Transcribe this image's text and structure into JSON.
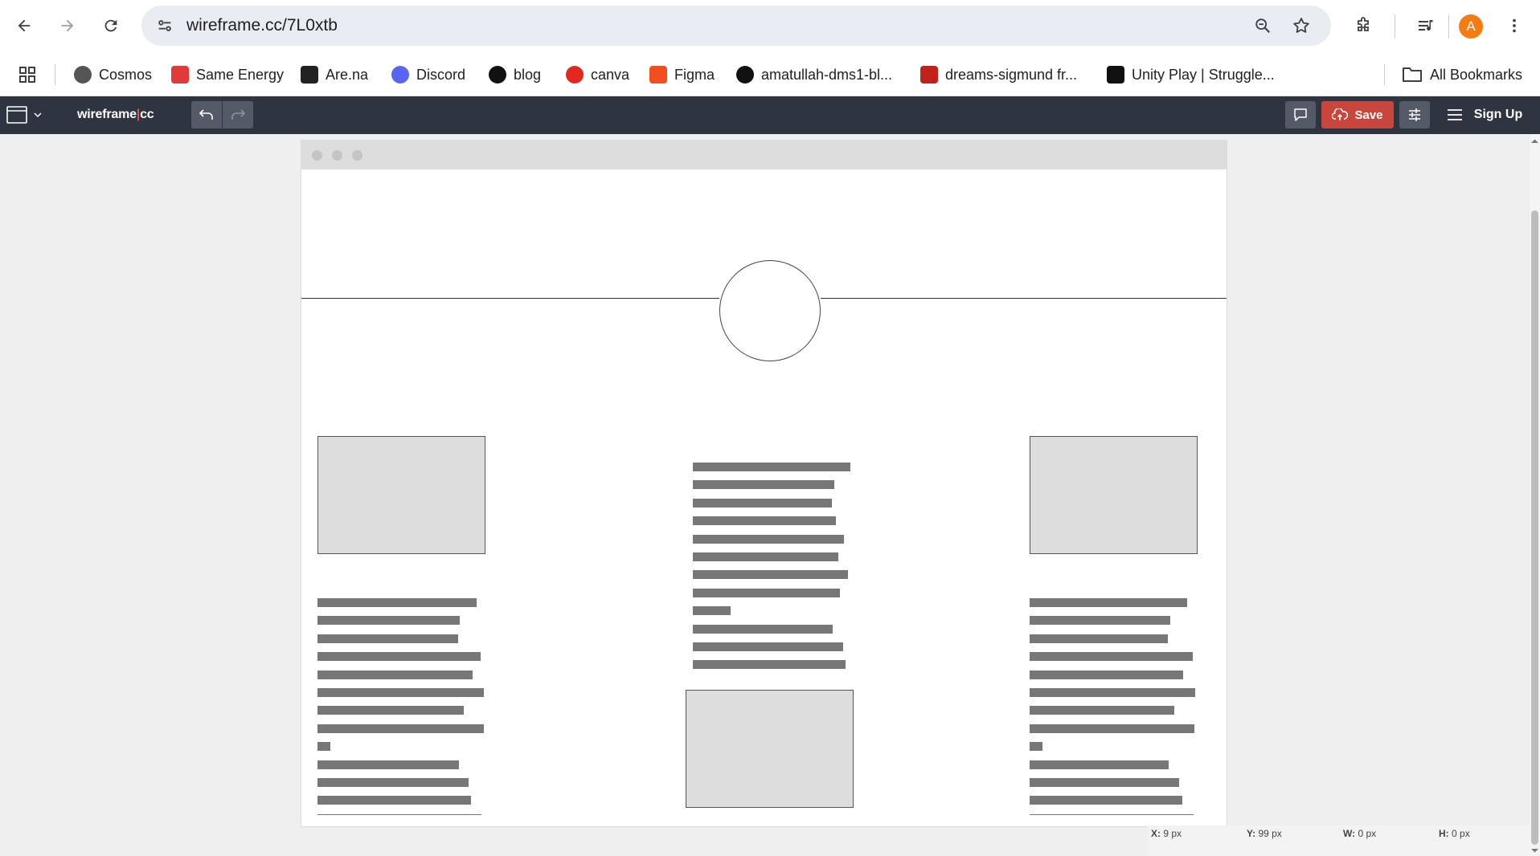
{
  "browser": {
    "url": "wireframe.cc/7L0xtb",
    "profile_initial": "A",
    "bookmarks": [
      {
        "label": "Cosmos",
        "icon": "cosmos-icon",
        "color": "#555555"
      },
      {
        "label": "Same Energy",
        "icon": "bolt-icon",
        "color": "#e23a3a"
      },
      {
        "label": "Are.na",
        "icon": "arena-icon",
        "color": "#222222"
      },
      {
        "label": "Discord",
        "icon": "discord-icon",
        "color": "#5865f2"
      },
      {
        "label": "blog",
        "icon": "github-icon",
        "color": "#111111"
      },
      {
        "label": "canva",
        "icon": "canva-icon",
        "color": "#e5281f"
      },
      {
        "label": "Figma",
        "icon": "figma-icon",
        "color": "#f24e1e"
      },
      {
        "label": "amatullah-dms1-bl...",
        "icon": "github-icon",
        "color": "#111111"
      },
      {
        "label": "dreams-sigmund fr...",
        "icon": "pdf-icon",
        "color": "#c0221a"
      },
      {
        "label": "Unity Play | Struggle...",
        "icon": "unity-icon",
        "color": "#111111"
      }
    ],
    "all_bookmarks_label": "All Bookmarks"
  },
  "app": {
    "brand_left": "wireframe",
    "brand_sep": "|",
    "brand_right": "cc",
    "save_label": "Save",
    "signup_label": "Sign Up",
    "accent": "#c9463d"
  },
  "status": {
    "x_label": "X:",
    "x_value": "9 px",
    "y_label": "Y:",
    "y_value": "99 px",
    "w_label": "W:",
    "w_value": "0 px",
    "h_label": "H:",
    "h_value": "0 px"
  }
}
